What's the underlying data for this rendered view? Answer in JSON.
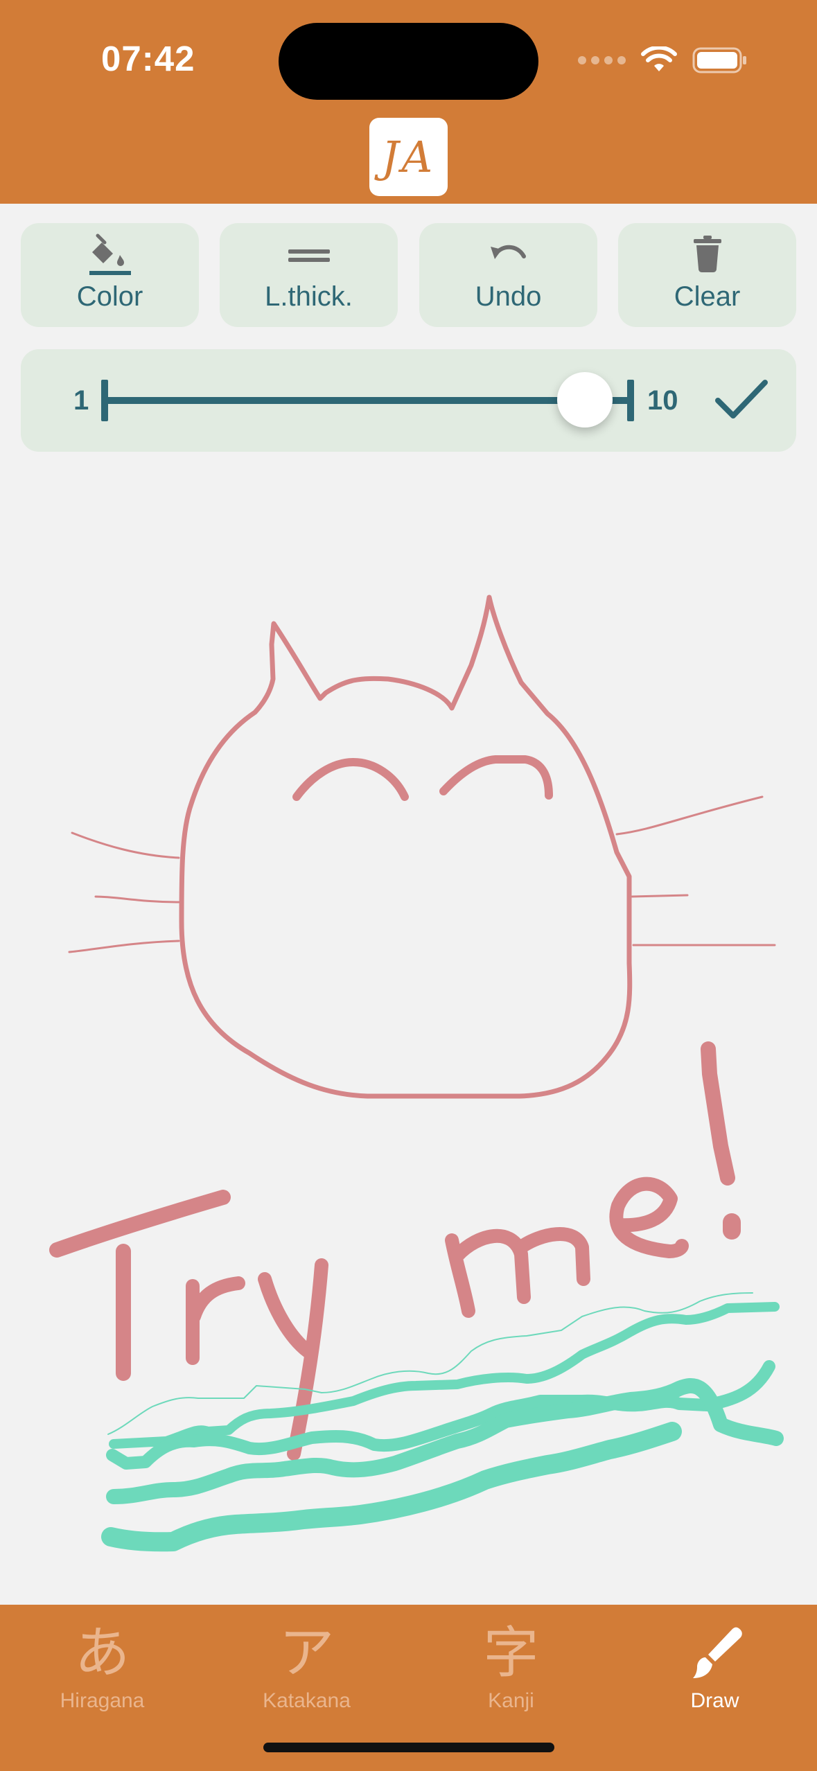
{
  "status_bar": {
    "time": "07:42"
  },
  "app": {
    "logo_text": "JA"
  },
  "toolbar": {
    "buttons": [
      {
        "label": "Color",
        "icon": "paint-bucket-icon"
      },
      {
        "label": "L.thick.",
        "icon": "line-thickness-icon"
      },
      {
        "label": "Undo",
        "icon": "undo-icon"
      },
      {
        "label": "Clear",
        "icon": "trash-icon"
      }
    ]
  },
  "thickness_slider": {
    "min_label": "1",
    "max_label": "10",
    "min": 1,
    "max": 10,
    "value": 9.2
  },
  "canvas": {
    "drawing_text": "Try me!",
    "stroke_colors": {
      "pink": "#d58588",
      "mint": "#6dd9bb"
    }
  },
  "tabbar": {
    "tabs": [
      {
        "glyph": "あ",
        "label": "Hiragana",
        "active": false
      },
      {
        "glyph": "ア",
        "label": "Katakana",
        "active": false
      },
      {
        "glyph": "字",
        "label": "Kanji",
        "active": false
      },
      {
        "glyph": "brush-icon",
        "label": "Draw",
        "active": true
      }
    ]
  },
  "colors": {
    "header": "#d27c37",
    "panel": "#e1ebe1",
    "accent_text": "#2e6775",
    "tab_inactive": "#eab58d",
    "background": "#f2f2f2"
  }
}
